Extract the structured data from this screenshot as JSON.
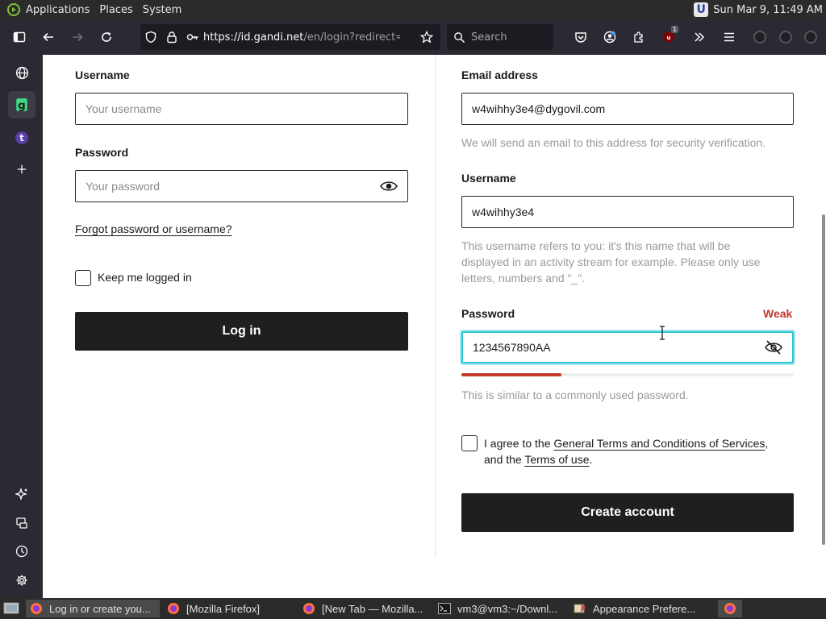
{
  "top_panel": {
    "menus": [
      "Applications",
      "Places",
      "System"
    ],
    "clock": "Sun Mar  9, 11:49 AM"
  },
  "toolbar": {
    "url_host": "https://id.gandi.net",
    "url_path": "/en/login?redirect=",
    "search_placeholder": "Search",
    "ublock_badge": "1"
  },
  "login": {
    "username_label": "Username",
    "username_placeholder": "Your username",
    "password_label": "Password",
    "password_placeholder": "Your password",
    "forgot_link": "Forgot password or username?",
    "keep_logged_label": "Keep me logged in",
    "login_button": "Log in"
  },
  "signup": {
    "email_label": "Email address",
    "email_value": "w4wihhy3e4@dygovil.com",
    "email_hint": "We will send an email to this address for security verification.",
    "username_label": "Username",
    "username_value": "w4wihhy3e4",
    "username_hint_line1": "This username refers to you: it's this name that will be",
    "username_hint_line2": "displayed in an activity stream for example. Please only use",
    "username_hint_line3": "letters, numbers and \"_\".",
    "password_label": "Password",
    "password_strength": "Weak",
    "password_value": "1234567890AA",
    "password_strength_fraction": 0.3,
    "password_hint": "This is similar to a commonly used password.",
    "agree_prefix": "I agree to the ",
    "terms_link": "General Terms and Conditions of Services",
    "agree_middle": "and the ",
    "terms_use_link": "Terms of use",
    "create_button": "Create account"
  },
  "colors": {
    "accent_focus": "#2ac6d1",
    "weak": "#c0392b"
  },
  "taskbar": {
    "tasks": [
      "Log in or create you...",
      "[Mozilla Firefox]",
      "[New Tab — Mozilla...",
      "vm3@vm3:~/Downl...",
      "Appearance Prefere..."
    ]
  }
}
